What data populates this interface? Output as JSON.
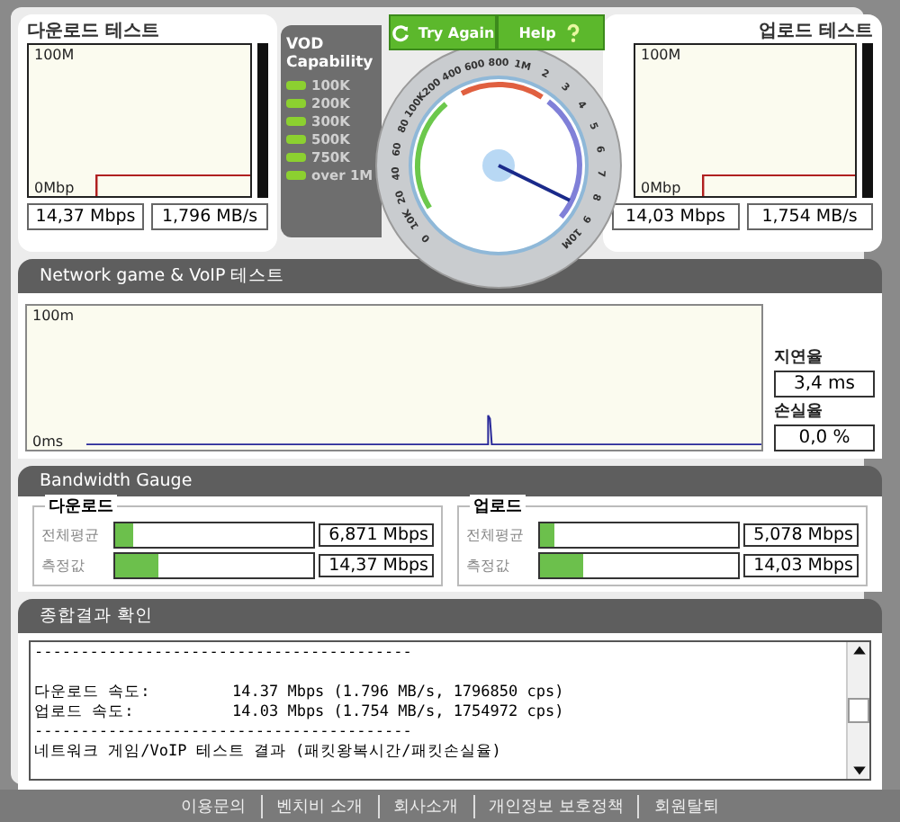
{
  "download_test": {
    "title": "다운로드 테스트",
    "graph_top": "100M",
    "graph_bottom": "0Mbp",
    "speed": "14,37 Mbps",
    "rate": "1,796 MB/s"
  },
  "vod": {
    "title": "VOD Capability",
    "levels": [
      {
        "label": "100K",
        "lit": true
      },
      {
        "label": "200K",
        "lit": true
      },
      {
        "label": "300K",
        "lit": true
      },
      {
        "label": "500K",
        "lit": true
      },
      {
        "label": "750K",
        "lit": true
      },
      {
        "label": "over 1M",
        "lit": true
      }
    ]
  },
  "buttons": [
    {
      "label": "Try Again",
      "kind": "retry"
    },
    {
      "label": "Help",
      "kind": "help"
    }
  ],
  "dial": {
    "ticks": [
      "0",
      "10K",
      "20",
      "40",
      "60",
      "80",
      "100K",
      "200",
      "400",
      "600",
      "800",
      "1M",
      "2",
      "3",
      "4",
      "5",
      "6",
      "7",
      "8",
      "9",
      "10M"
    ]
  },
  "upload_test": {
    "title": "업로드 테스트",
    "graph_top": "100M",
    "graph_bottom": "0Mbp",
    "speed": "14,03 Mbps",
    "rate": "1,754 MB/s"
  },
  "network_test": {
    "title": "Network game & VoIP 테스트",
    "graph_top": "100m",
    "graph_bottom": "0ms",
    "latency_label": "지연율",
    "latency": "3,4 ms",
    "loss_label": "손실율",
    "loss": "0,0 %"
  },
  "bandwidth": {
    "title": "Bandwidth Gauge",
    "groups": [
      {
        "title": "다운로드",
        "rows": [
          {
            "label": "전체평균",
            "level": 0.09,
            "value": "6,871 Mbps"
          },
          {
            "label": "측정값",
            "level": 0.22,
            "value": "14,37 Mbps"
          }
        ]
      },
      {
        "title": "업로드",
        "rows": [
          {
            "label": "전체평균",
            "level": 0.07,
            "value": "5,078 Mbps"
          },
          {
            "label": "측정값",
            "level": 0.22,
            "value": "14,03 Mbps"
          }
        ]
      }
    ]
  },
  "summary": {
    "title": "종합결과 확인",
    "lines": [
      {
        "kind": "rule",
        "text": "-----------------------------------------"
      },
      {
        "kind": "speed",
        "label": "다운로드 속도:",
        "value": "14.37 Mbps (1.796 MB/s, 1796850 cps)"
      },
      {
        "kind": "speed",
        "label": "업로드 속도:",
        "value": "14.03 Mbps (1.754 MB/s, 1754972 cps)"
      },
      {
        "kind": "rule",
        "text": "-----------------------------------------"
      },
      {
        "kind": "text",
        "text": "네트워크 게임/VoIP 테스트 결과 (패킷왕복시간/패킷손실율)"
      }
    ]
  },
  "footer_links": [
    "이용문의",
    "벤치비 소개",
    "회사소개",
    "개인정보 보호정책",
    "회원탈퇴"
  ]
}
